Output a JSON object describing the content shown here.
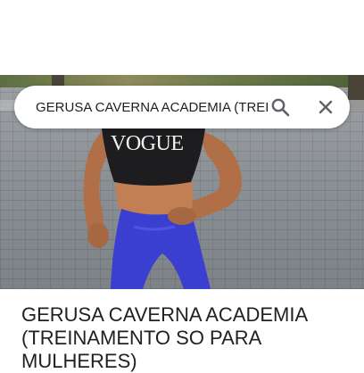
{
  "search": {
    "query": "GERUSA CAVERNA ACADEMIA (TREINAMENTO SO PARA MULHERES)",
    "search_icon": "search-icon",
    "clear_icon": "close-icon"
  },
  "photo": {
    "shirt_text": "VOGUE"
  },
  "result": {
    "title": "GERUSA CAVERNA ACADEMIA (TREINAMENTO SO PARA MULHERES)"
  },
  "colors": {
    "text": "#202124",
    "icon": "#5f6368",
    "leggings": "#3b3fd0",
    "skin": "#b9764e",
    "top": "#1d1d1f"
  }
}
